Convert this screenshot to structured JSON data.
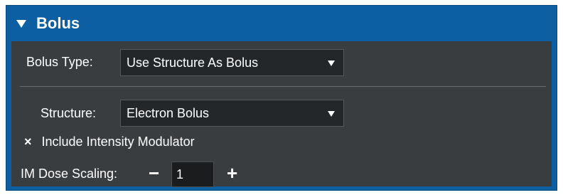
{
  "panel": {
    "title": "Bolus",
    "expanded": true
  },
  "bolus_type": {
    "label": "Bolus Type:",
    "value": "Use Structure As Bolus"
  },
  "structure": {
    "label": "Structure:",
    "value": "Electron Bolus"
  },
  "intensity_modulator": {
    "label": "Include Intensity Modulator",
    "checked": true,
    "check_glyph": "×"
  },
  "im_dose_scaling": {
    "label": "IM Dose Scaling:",
    "minus": "−",
    "value": "1",
    "plus": "+"
  },
  "colors": {
    "header_blue": "#0d5fa3",
    "body_gray": "#3a3d40",
    "field_dark": "#24272a"
  }
}
